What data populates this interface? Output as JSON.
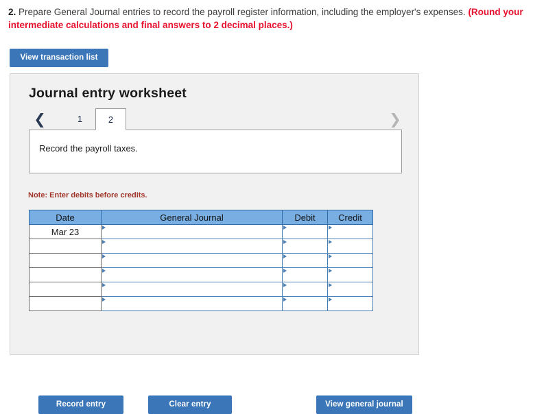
{
  "prompt": {
    "number": "2.",
    "text": " Prepare General Journal entries to record the payroll register information, including the employer's expenses. ",
    "round_note": "(Round your intermediate calculations and final answers to 2 decimal places.)"
  },
  "toolbar": {
    "view_transaction_list_label": "View transaction list"
  },
  "panel": {
    "title": "Journal entry worksheet",
    "tabs": [
      {
        "label": "1",
        "active": false
      },
      {
        "label": "2",
        "active": true
      }
    ],
    "prev_icon": "chevron-left-icon",
    "next_icon": "chevron-right-icon",
    "description": "Record the payroll taxes.",
    "note": "Note: Enter debits before credits."
  },
  "table": {
    "headers": [
      "Date",
      "General Journal",
      "Debit",
      "Credit"
    ],
    "rows": [
      {
        "date": "Mar 23",
        "general_journal": "",
        "debit": "",
        "credit": ""
      },
      {
        "date": "",
        "general_journal": "",
        "debit": "",
        "credit": ""
      },
      {
        "date": "",
        "general_journal": "",
        "debit": "",
        "credit": ""
      },
      {
        "date": "",
        "general_journal": "",
        "debit": "",
        "credit": ""
      },
      {
        "date": "",
        "general_journal": "",
        "debit": "",
        "credit": ""
      },
      {
        "date": "",
        "general_journal": "",
        "debit": "",
        "credit": ""
      }
    ]
  },
  "footer": {
    "record_entry_label": "Record entry",
    "clear_entry_label": "Clear entry",
    "view_general_journal_label": "View general journal"
  },
  "colors": {
    "button_blue": "#3a76b8",
    "header_blue": "#79aee3",
    "round_red": "#e8112d",
    "note_red": "#a1372b",
    "panel_gray": "#f1f1f1"
  }
}
